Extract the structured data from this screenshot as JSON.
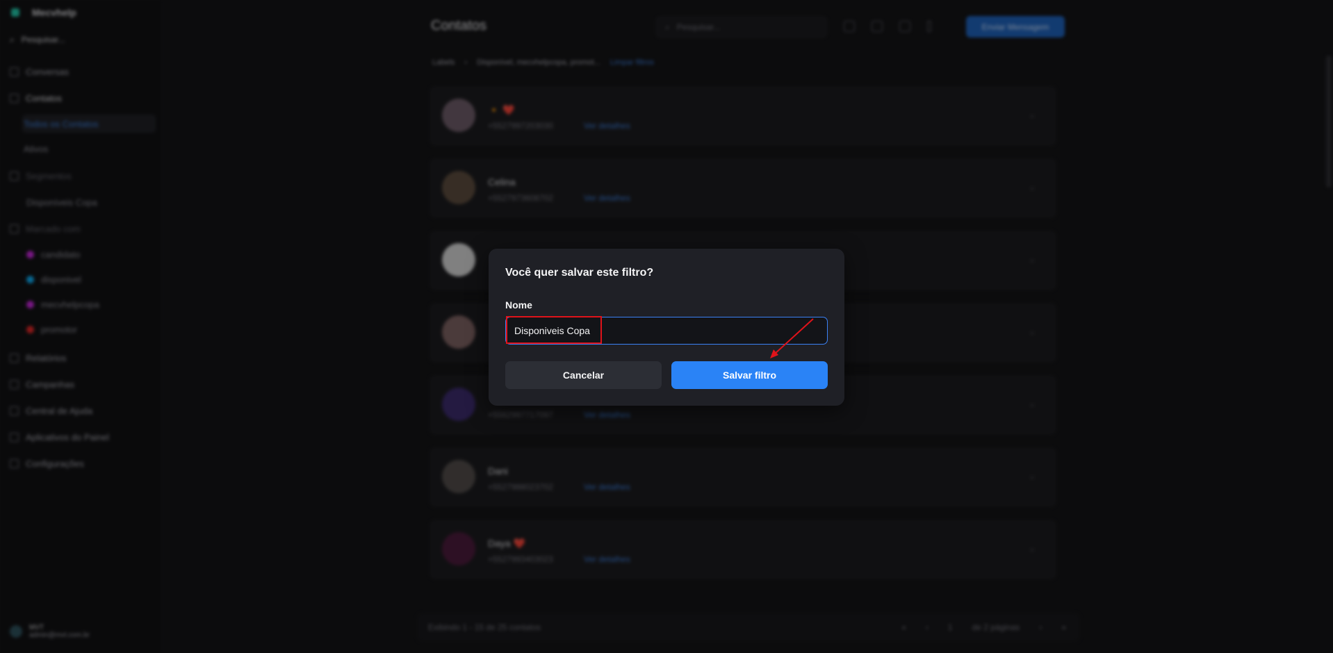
{
  "sidebar": {
    "brand": "Mecvhelp",
    "search": "Pesquisar...",
    "items": [
      {
        "label": "Conversas",
        "icon": "chat-icon"
      },
      {
        "label": "Contatos",
        "icon": "contacts-icon"
      },
      {
        "label": "Todos os Contatos"
      },
      {
        "label": "Ativos"
      },
      {
        "label": "Segmentos",
        "icon": "segment-icon"
      },
      {
        "label": "Disponíveis Copa"
      },
      {
        "label": "Marcado com",
        "icon": "tag-icon"
      },
      {
        "label": "candidato",
        "color": "#c026d3"
      },
      {
        "label": "disponivel",
        "color": "#0ea5e9"
      },
      {
        "label": "mecvhelpcopa",
        "color": "#c026d3"
      },
      {
        "label": "promotor",
        "color": "#dc2626"
      },
      {
        "label": "Relatórios",
        "icon": "report-icon"
      },
      {
        "label": "Campanhas",
        "icon": "campaign-icon"
      },
      {
        "label": "Central de Ajuda",
        "icon": "help-icon"
      },
      {
        "label": "Aplicativos do Painel",
        "icon": "apps-icon"
      },
      {
        "label": "Configurações",
        "icon": "settings-icon"
      }
    ],
    "user": {
      "name": "MVT",
      "email": "admin@mvt.com.br"
    }
  },
  "header": {
    "title": "Contatos",
    "search_placeholder": "Pesquisar...",
    "send_label": "Enviar Mensagem"
  },
  "filters": {
    "label": "Labels",
    "value": "Disponível, mecvhelpcopa, promot...",
    "clear": "Limpar filtros"
  },
  "contacts": [
    {
      "name": "🔸 ❤️",
      "phone": "+5527997203030",
      "details": "Ver detalhes"
    },
    {
      "name": "Celina",
      "phone": "+5527973608702",
      "details": "Ver detalhes"
    },
    {
      "name": "",
      "phone": "",
      "details": ""
    },
    {
      "name": "",
      "phone": "",
      "details": ""
    },
    {
      "name": "",
      "phone": "+5562997717097",
      "details": "Ver detalhes"
    },
    {
      "name": "Dani",
      "phone": "+5527988023702",
      "details": "Ver detalhes"
    },
    {
      "name": "Daya ❤️",
      "phone": "+5527993403023",
      "details": "Ver detalhes"
    }
  ],
  "footer": {
    "info": "Exibindo 1 - 15 de 25 contatos",
    "page": "1",
    "total": "de 2 páginas"
  },
  "modal": {
    "title": "Você quer salvar este filtro?",
    "field_label": "Nome",
    "input_value": "Disponiveis Copa",
    "cancel_label": "Cancelar",
    "save_label": "Salvar filtro"
  },
  "colors": {
    "accent": "#2a83f6",
    "annotation": "#e0131a"
  }
}
